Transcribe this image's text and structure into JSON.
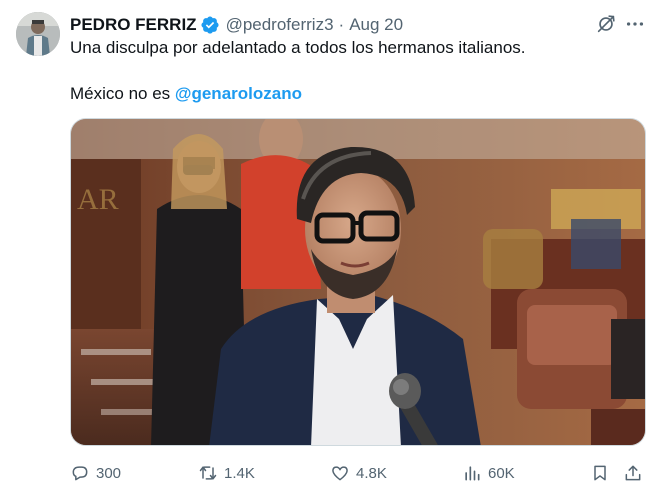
{
  "author": {
    "name": "PEDRO FERRIZ",
    "handle": "@pedroferriz3",
    "separator": "·",
    "date": "Aug 20"
  },
  "tweet": {
    "line1": "Una disculpa por adelantado a todos los hermanos italianos.",
    "line2_prefix": "México no es ",
    "mention": "@genarolozano"
  },
  "icons": {
    "verified": "verified-badge-icon",
    "grok": "grok-icon",
    "more": "more-options-icon",
    "reply": "reply-icon",
    "repost": "repost-icon",
    "like": "like-icon",
    "views": "views-icon",
    "bookmark": "bookmark-icon",
    "share": "share-icon"
  },
  "stats": {
    "replies": "300",
    "reposts": "1.4K",
    "likes": "4.8K",
    "views": "60K"
  },
  "colors": {
    "text": "#0f1419",
    "secondary": "#536471",
    "link": "#1d9bf0",
    "verified": "#1d9bf0"
  }
}
